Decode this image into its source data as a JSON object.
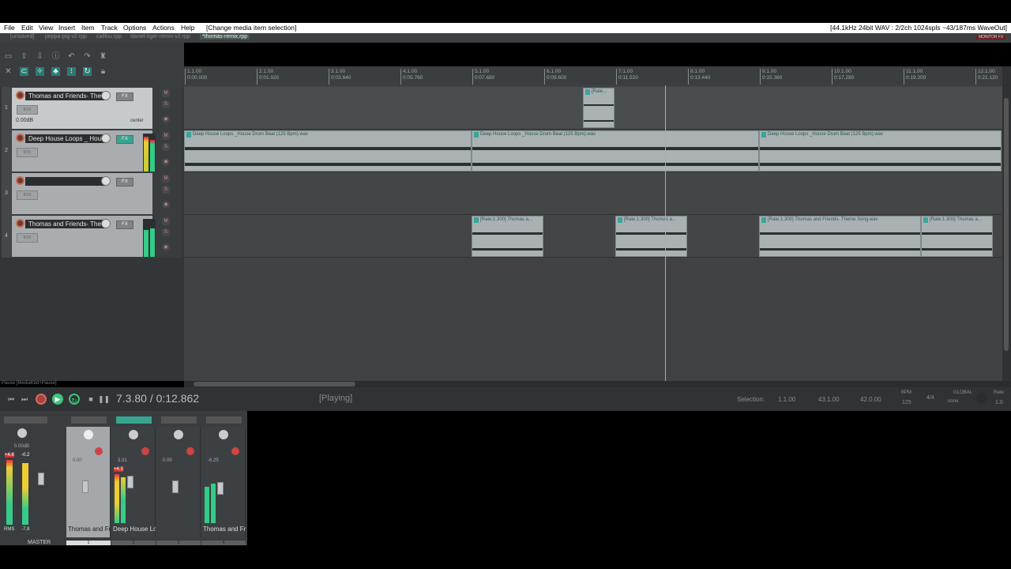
{
  "menu": [
    "File",
    "Edit",
    "View",
    "Insert",
    "Item",
    "Track",
    "Options",
    "Actions",
    "Help",
    "[Change media item selection]"
  ],
  "audio_status": "[44.1kHz 24bit WAV : 2/2ch 1024spls ~43/187ms WaveOut]",
  "tabs": [
    "[unsaved]",
    "peppa-pig-v2.rpp",
    "caillou.rpp",
    "daniel-tiger-remix-v2.rpp",
    "*thomas-remix.rpp"
  ],
  "monitor_fx": "MONITOR FX",
  "ruler": [
    {
      "bar": "1.1.00",
      "time": "0:00.000"
    },
    {
      "bar": "2.1.00",
      "time": "0:01.920"
    },
    {
      "bar": "3.1.00",
      "time": "0:03.840"
    },
    {
      "bar": "4.1.00",
      "time": "0:05.760"
    },
    {
      "bar": "5.1.00",
      "time": "0:07.680"
    },
    {
      "bar": "6.1.00",
      "time": "0:09.600"
    },
    {
      "bar": "7.1.00",
      "time": "0:11.520"
    },
    {
      "bar": "8.1.00",
      "time": "0:13.440"
    },
    {
      "bar": "9.1.00",
      "time": "0:15.360"
    },
    {
      "bar": "10.1.00",
      "time": "0:17.280"
    },
    {
      "bar": "11.1.00",
      "time": "0:19.200"
    },
    {
      "bar": "12.1.00",
      "time": "0:21.120"
    }
  ],
  "tracks": [
    {
      "num": "1",
      "name": "Thomas and Friends- The",
      "volume": "0.00dB",
      "pan": "center",
      "trim": "trim",
      "fx": "FX"
    },
    {
      "num": "2",
      "name": "Deep House Loops _ Hou",
      "volume": "",
      "pan": "",
      "trim": "trim",
      "fx": "FX"
    },
    {
      "num": "3",
      "name": "",
      "volume": "",
      "pan": "",
      "trim": "trim",
      "fx": "FX"
    },
    {
      "num": "4",
      "name": "Thomas and Friends- The",
      "volume": "",
      "pan": "",
      "trim": "trim",
      "fx": "FX"
    }
  ],
  "items": {
    "t1": [
      "[Rate..."
    ],
    "t2": [
      "Deep House Loops _House Drum Beat (125 Bpm).wav",
      "Deep House Loops _House Drum Beat (125 Bpm).wav",
      "Deep House Loops _House Drum Beat (125 Bpm).wav"
    ],
    "t4": [
      "[Rate:1.300] Thomas a...",
      "[Rate:1.300] Thomas a...",
      "[Rate:1.300] Thomas and Friends- Theme Song.wav",
      "[Rate:1.300] Thomas a..."
    ]
  },
  "transport": {
    "action_hint": "Pause [MediaKbd+Pause]",
    "time": "7.3.80 / 0:12.862",
    "status": "[Playing]",
    "selection_label": "Selection:",
    "sel_start": "1.1.00",
    "sel_end": "43.1.00",
    "sel_len": "42.0.00",
    "bpm_label": "BPM",
    "bpm": "125",
    "timesig": "4/4",
    "global": "GLOBAL",
    "global_mode": "none",
    "rate_label": "Rate:",
    "rate": "1.0"
  },
  "mixer": {
    "master_label": "MASTER",
    "master_vol": "0.00dB",
    "master_peak_l": "+4.6",
    "master_peak_r": "-0.2",
    "rms": "RMS",
    "rms_val": "-7.8",
    "strips": [
      {
        "name": "Thomas and Fr",
        "num": "1",
        "vol": "0.00"
      },
      {
        "name": "Deep House Lo",
        "num": "2",
        "vol": "3.31",
        "peak": "+4.3"
      },
      {
        "name": "",
        "num": "3",
        "vol": "0.00"
      },
      {
        "name": "Thomas and Fr",
        "num": "4",
        "vol": "-6.25"
      }
    ]
  }
}
